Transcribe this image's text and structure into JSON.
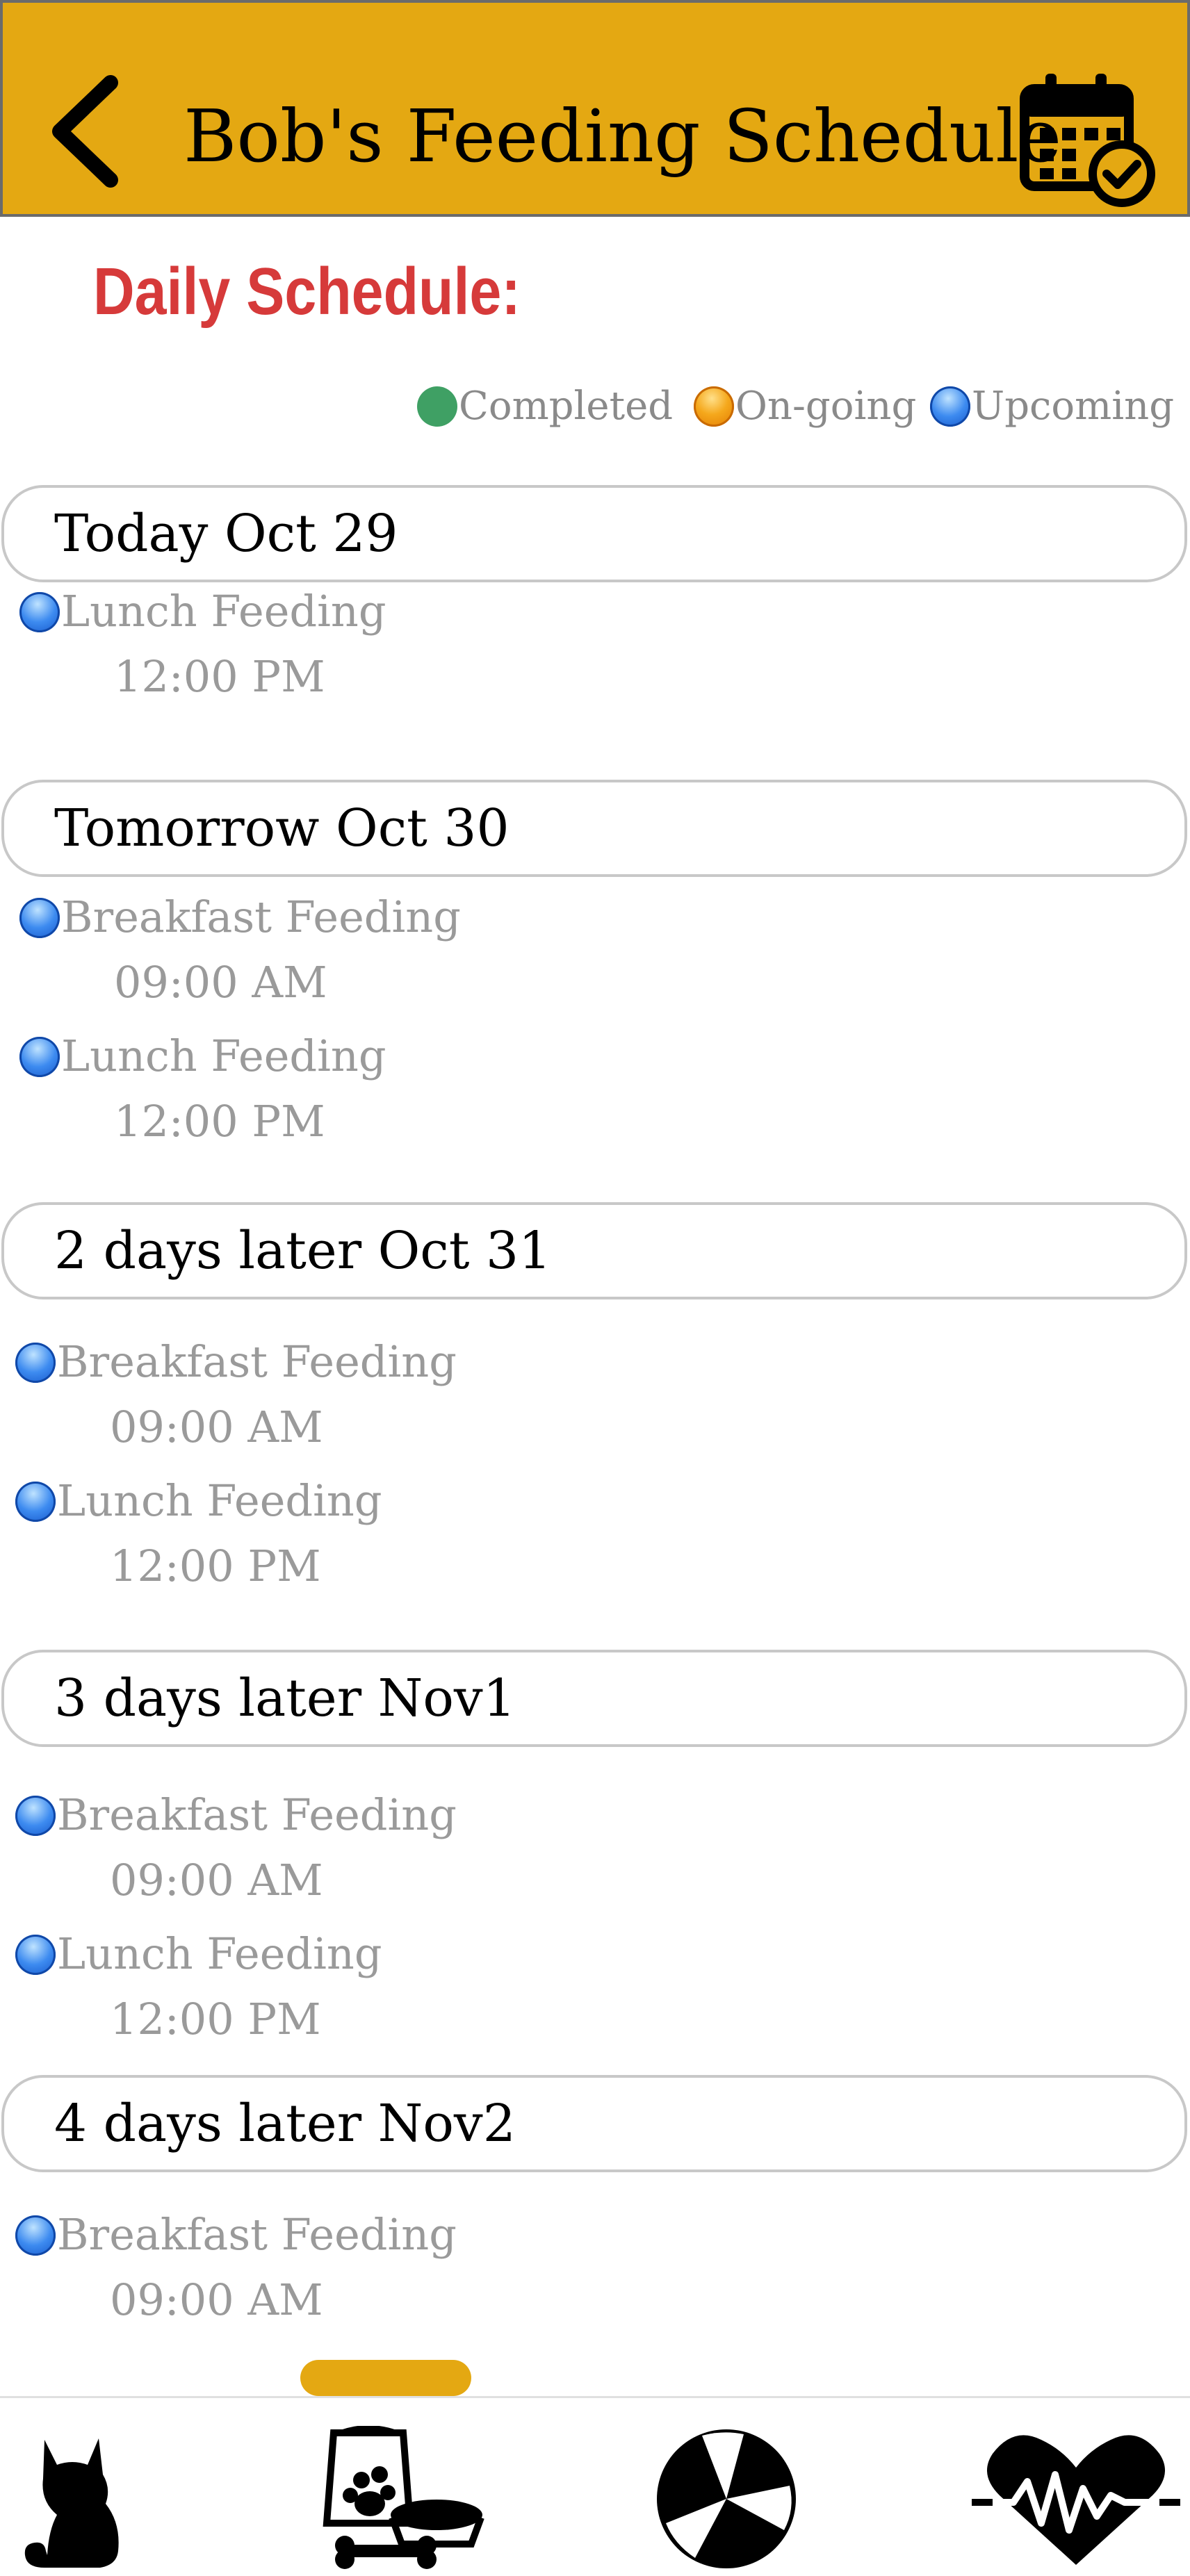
{
  "header": {
    "title": "Bob's Feeding Schedule",
    "back_icon": "chevron-left-icon",
    "calendar_icon": "calendar-check-icon",
    "background": "#E4A812"
  },
  "section_title": "Daily Schedule:",
  "legend": [
    {
      "label": "Completed",
      "status": "completed",
      "color": "#3FA064"
    },
    {
      "label": "On-going",
      "status": "ongoing",
      "color": "#F5A81C"
    },
    {
      "label": "Upcoming",
      "status": "upcoming",
      "color": "#3D8BF0"
    }
  ],
  "days": [
    {
      "label": "Today Oct 29",
      "feedings": [
        {
          "name": "Lunch Feeding",
          "time": "12:00 PM",
          "status": "upcoming"
        }
      ]
    },
    {
      "label": "Tomorrow Oct 30",
      "feedings": [
        {
          "name": "Breakfast Feeding",
          "time": "09:00 AM",
          "status": "upcoming"
        },
        {
          "name": "Lunch Feeding",
          "time": "12:00 PM",
          "status": "upcoming"
        }
      ]
    },
    {
      "label": "2 days later Oct 31",
      "feedings": [
        {
          "name": "Breakfast Feeding",
          "time": "09:00 AM",
          "status": "upcoming"
        },
        {
          "name": "Lunch Feeding",
          "time": "12:00 PM",
          "status": "upcoming"
        }
      ]
    },
    {
      "label": "3 days later Nov1",
      "feedings": [
        {
          "name": "Breakfast Feeding",
          "time": "09:00 AM",
          "status": "upcoming"
        },
        {
          "name": "Lunch Feeding",
          "time": "12:00 PM",
          "status": "upcoming"
        }
      ]
    },
    {
      "label": "4 days later Nov2",
      "feedings": [
        {
          "name": "Breakfast Feeding",
          "time": "09:00 AM",
          "status": "upcoming"
        }
      ]
    }
  ],
  "tabbar": [
    {
      "icon": "cat-icon"
    },
    {
      "icon": "pet-food-icon"
    },
    {
      "icon": "ball-icon"
    },
    {
      "icon": "heartbeat-icon"
    }
  ]
}
